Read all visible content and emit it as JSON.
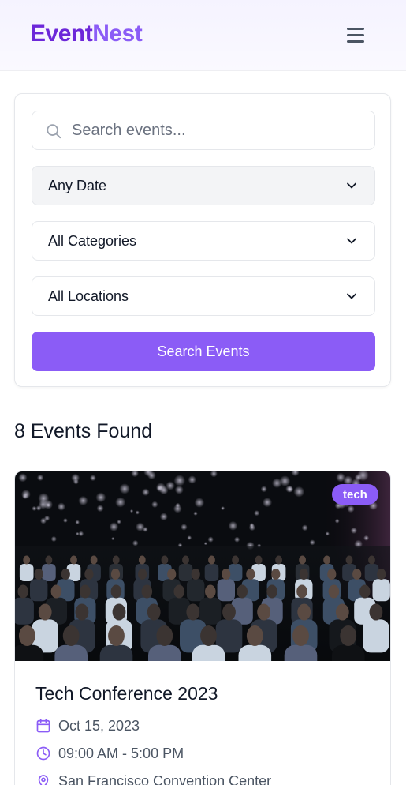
{
  "header": {
    "logo_part1": "Event",
    "logo_part2": "Nest",
    "menu_icon": "hamburger-menu-icon"
  },
  "search": {
    "search_icon": "search-icon",
    "placeholder": "Search events...",
    "value": "",
    "date_filter": "Any Date",
    "category_filter": "All Categories",
    "location_filter": "All Locations",
    "dropdown_icon": "chevron-down-icon",
    "button_label": "Search Events"
  },
  "results": {
    "title": "8 Events Found"
  },
  "events": [
    {
      "tag": "tech",
      "title": "Tech Conference 2023",
      "date": "Oct 15, 2023",
      "time": "09:00 AM - 5:00 PM",
      "location": "San Francisco Convention Center",
      "icons": [
        "calendar-icon",
        "clock-icon",
        "map-pin-icon"
      ],
      "image": "conference-audience-photo"
    }
  ],
  "colors": {
    "brand_dark": "#6d28d9",
    "brand": "#8b5cf6",
    "header_bg": "#f5f3ff",
    "text": "#111827",
    "muted": "#4b5563"
  }
}
